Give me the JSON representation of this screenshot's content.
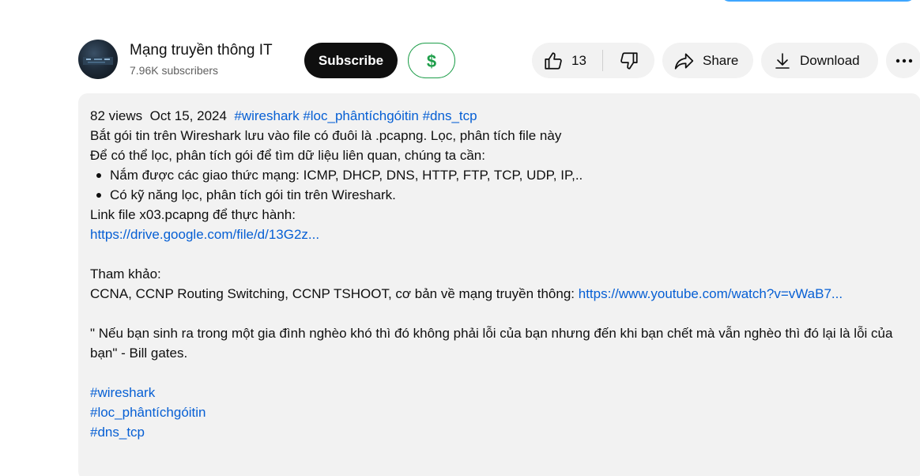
{
  "channel": {
    "name": "Mạng truyền thông IT",
    "subscribers": "7.96K subscribers",
    "subscribe_label": "Subscribe",
    "thanks_symbol": "$"
  },
  "actions": {
    "like_count": "13",
    "share_label": "Share",
    "download_label": "Download"
  },
  "description": {
    "views": "82 views",
    "date": "Oct 15, 2024",
    "tags_inline": [
      "#wireshark",
      "#loc_phântíchgóitin",
      "#dns_tcp"
    ],
    "line1": "Bắt gói tin trên Wireshark lưu vào file có đuôi là .pcapng. Lọc, phân tích file này",
    "line2": "Để có thể lọc, phân tích gói để tìm dữ liệu liên quan, chúng ta cần:",
    "bullets": [
      "Nắm được các giao thức mạng: ICMP,  DHCP, DNS, HTTP, FTP, TCP, UDP, IP,..",
      "Có kỹ năng lọc, phân tích gói tin trên Wireshark."
    ],
    "link_label": "Link file x03.pcapng để thực hành:",
    "drive_link": "https://drive.google.com/file/d/13G2z...",
    "ref_heading": "Tham khảo:",
    "ref_text": "CCNA, CCNP Routing Switching, CCNP TSHOOT, cơ bản về mạng truyền thông: ",
    "ref_link": "https://www.youtube.com/watch?v=vWaB7...",
    "quote": "\" Nếu bạn sinh ra trong một gia đình nghèo khó thì đó không phải lỗi của bạn nhưng đến khi bạn chết mà vẫn nghèo thì đó lại là lỗi của bạn\" - Bill gates.",
    "tags": [
      "#wireshark",
      "#loc_phântíchgóitin",
      "#dns_tcp"
    ]
  },
  "colors": {
    "link": "#065fd4",
    "pill_bg": "#f2f2f2",
    "subscribe_bg": "#0f0f0f",
    "thanks_green": "#1e9e4a"
  },
  "icons": [
    "like-icon",
    "dislike-icon",
    "share-icon",
    "download-icon",
    "more-icon",
    "dollar-icon"
  ]
}
